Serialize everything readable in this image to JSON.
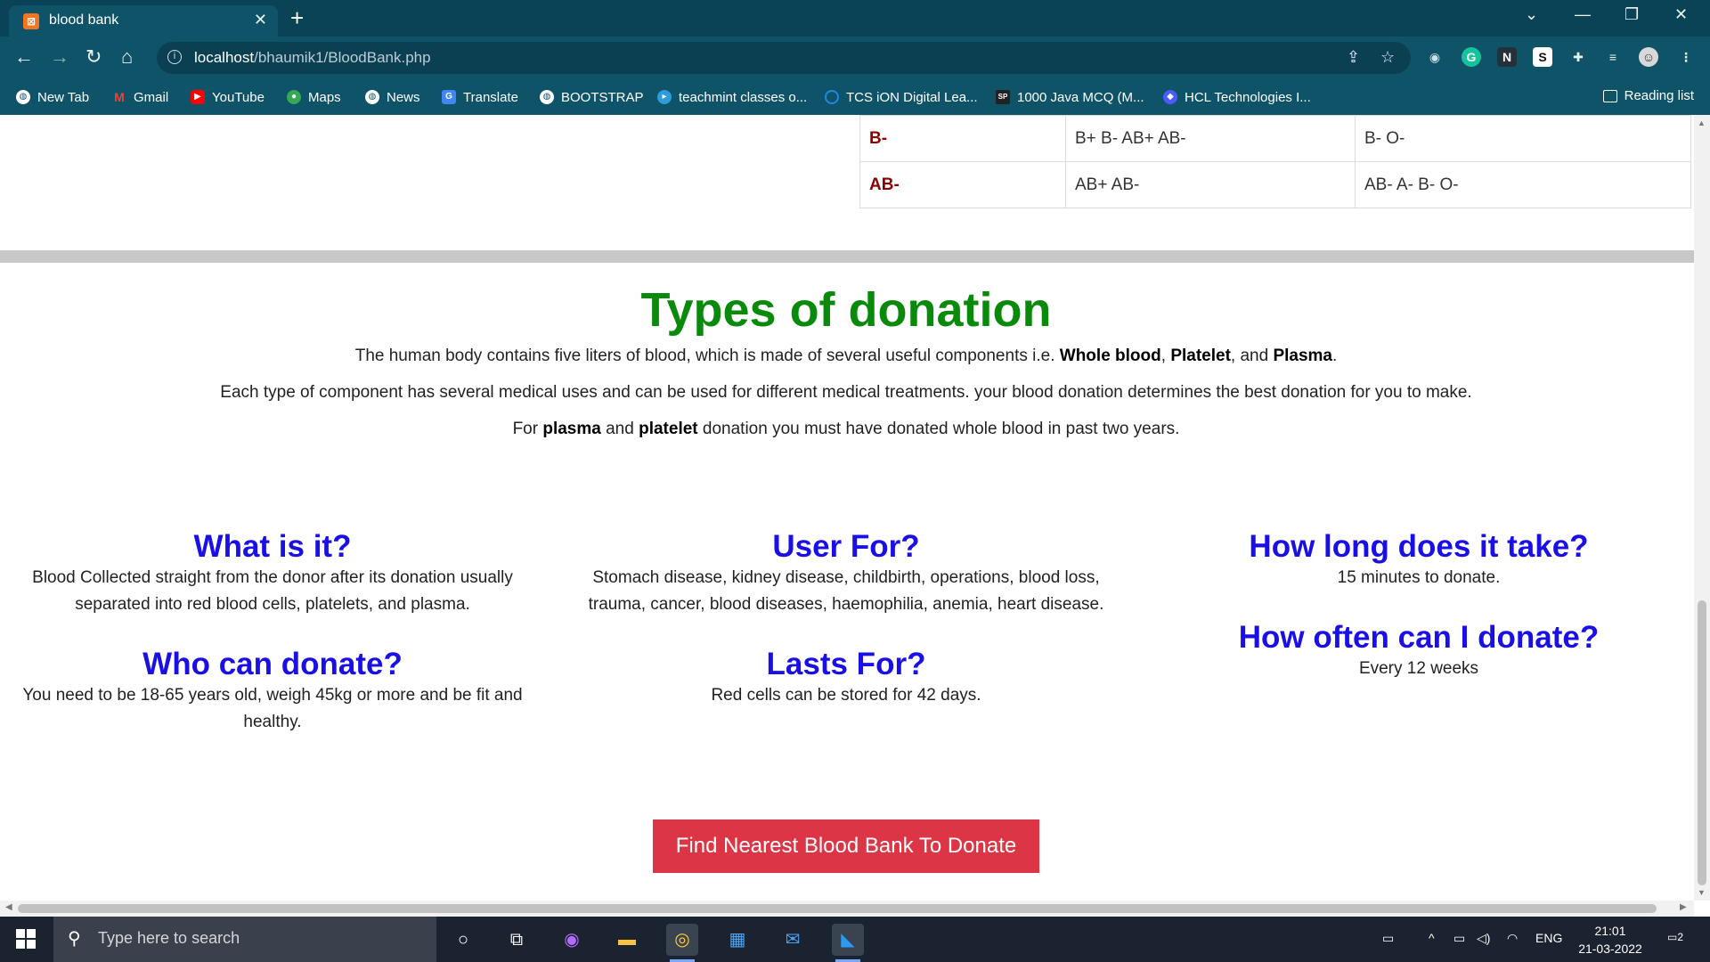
{
  "browser": {
    "tab_title": "blood bank",
    "tab_favicon_text": "⊠",
    "url_host": "localhost",
    "url_path": "/bhaumik1/BloodBank.php",
    "bookmarks": [
      {
        "label": "New Tab",
        "icon": "globe-icon",
        "color": "#ffffff"
      },
      {
        "label": "Gmail",
        "icon": "gmail-icon",
        "color": "#ea4335"
      },
      {
        "label": "YouTube",
        "icon": "youtube-icon",
        "color": "#ff0000"
      },
      {
        "label": "Maps",
        "icon": "maps-icon",
        "color": "#34a853"
      },
      {
        "label": "News",
        "icon": "globe-icon",
        "color": "#ffffff"
      },
      {
        "label": "Translate",
        "icon": "translate-icon",
        "color": "#4285f4"
      },
      {
        "label": "BOOTSTRAP",
        "icon": "globe-icon",
        "color": "#ffffff"
      },
      {
        "label": "teachmint classes o...",
        "icon": "teachmint-icon",
        "color": "#2d9cdb"
      },
      {
        "label": "TCS iON Digital Lea...",
        "icon": "tcs-icon",
        "color": "#1e88e5"
      },
      {
        "label": "1000 Java MCQ (M...",
        "icon": "java-icon",
        "color": "#222222"
      },
      {
        "label": "HCL Technologies I...",
        "icon": "hcl-icon",
        "color": "#4b5bff"
      }
    ],
    "reading_list": "Reading list"
  },
  "compat_rows": [
    {
      "group": "B-",
      "donate_to": "B+ B- AB+ AB-",
      "receive_from": "B- O-"
    },
    {
      "group": "AB-",
      "donate_to": "AB+ AB-",
      "receive_from": "AB- A- B- O-"
    }
  ],
  "donation": {
    "title": "Types of donation",
    "p1_pre": "The human body contains five liters of blood, which is made of several useful components i.e. ",
    "p1_b1": "Whole blood",
    "p1_sep1": ", ",
    "p1_b2": "Platelet",
    "p1_sep2": ", and ",
    "p1_b3": "Plasma",
    "p1_end": ".",
    "p2": "Each type of component has several medical uses and can be used for different medical treatments. your blood donation determines the best donation for you to make.",
    "p3_pre": "For ",
    "p3_b1": "plasma",
    "p3_mid": " and ",
    "p3_b2": "platelet",
    "p3_post": " donation you must have donated whole blood in past two years.",
    "what_title": "What is it?",
    "what_text": "Blood Collected straight from the donor after its donation usually separated into red blood cells, platelets, and plasma.",
    "who_title": "Who can donate?",
    "who_text": "You need to be 18-65 years old, weigh 45kg or more and be fit and healthy.",
    "used_title": "User For?",
    "used_text": "Stomach disease, kidney disease, childbirth, operations, blood loss, trauma, cancer, blood diseases, haemophilia, anemia, heart disease.",
    "lasts_title": "Lasts For?",
    "lasts_text": "Red cells can be stored for 42 days.",
    "howlong_title": "How long does it take?",
    "howlong_text": "15 minutes to donate.",
    "howoften_title": "How often can I donate?",
    "howoften_text": "Every 12 weeks",
    "cta": "Find Nearest Blood Bank To Donate"
  },
  "taskbar": {
    "search_placeholder": "Type here to search",
    "lang": "ENG",
    "time": "21:01",
    "date": "21-03-2022",
    "notifications": "2"
  },
  "colors": {
    "title_green": "#0a8a0a",
    "heading_blue": "#1a10e6",
    "cta_red": "#dc3545",
    "group_red": "#8b0000",
    "chrome_bg": "#0f5369"
  }
}
